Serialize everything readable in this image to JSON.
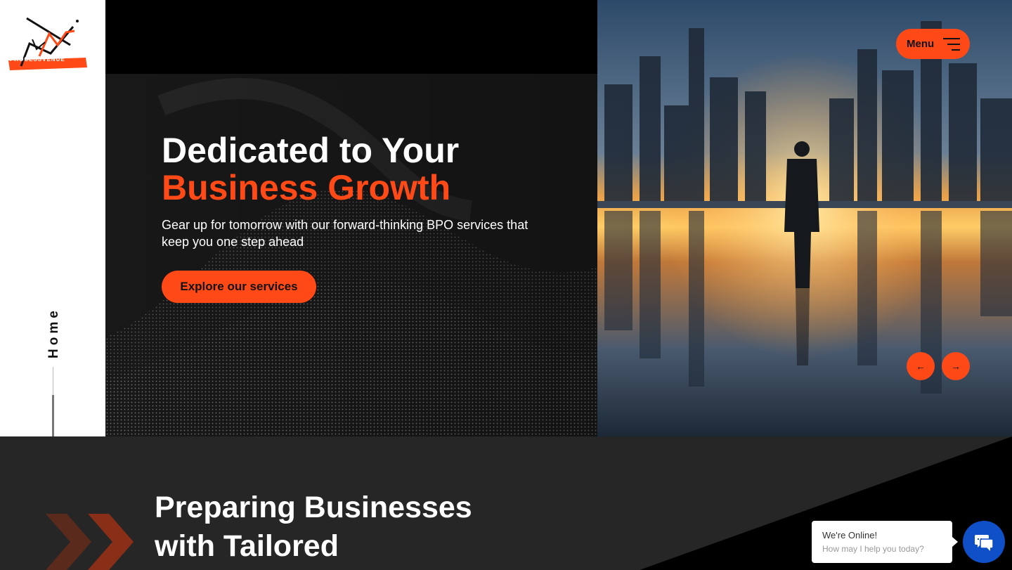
{
  "brand": {
    "logo_text": "PROCESSVENUE"
  },
  "sidebar": {
    "current_section": "Home"
  },
  "hero": {
    "title_line1": "Dedicated to Your",
    "title_line2": "Business Growth",
    "subtitle": "Gear up for tomorrow with our forward-thinking BPO services that keep you one step ahead",
    "cta_label": "Explore our services"
  },
  "nav": {
    "menu_label": "Menu"
  },
  "slider": {
    "prev_icon": "arrow-left-icon",
    "next_icon": "arrow-right-icon"
  },
  "section2": {
    "title_line1": "Preparing Businesses",
    "title_line2": "with Tailored"
  },
  "chat": {
    "status": "We're Online!",
    "prompt": "How may I help you today?",
    "icon": "chat-icon"
  },
  "colors": {
    "accent": "#ff4a17",
    "dark": "#262626",
    "chat_blue": "#0f4fc7"
  }
}
